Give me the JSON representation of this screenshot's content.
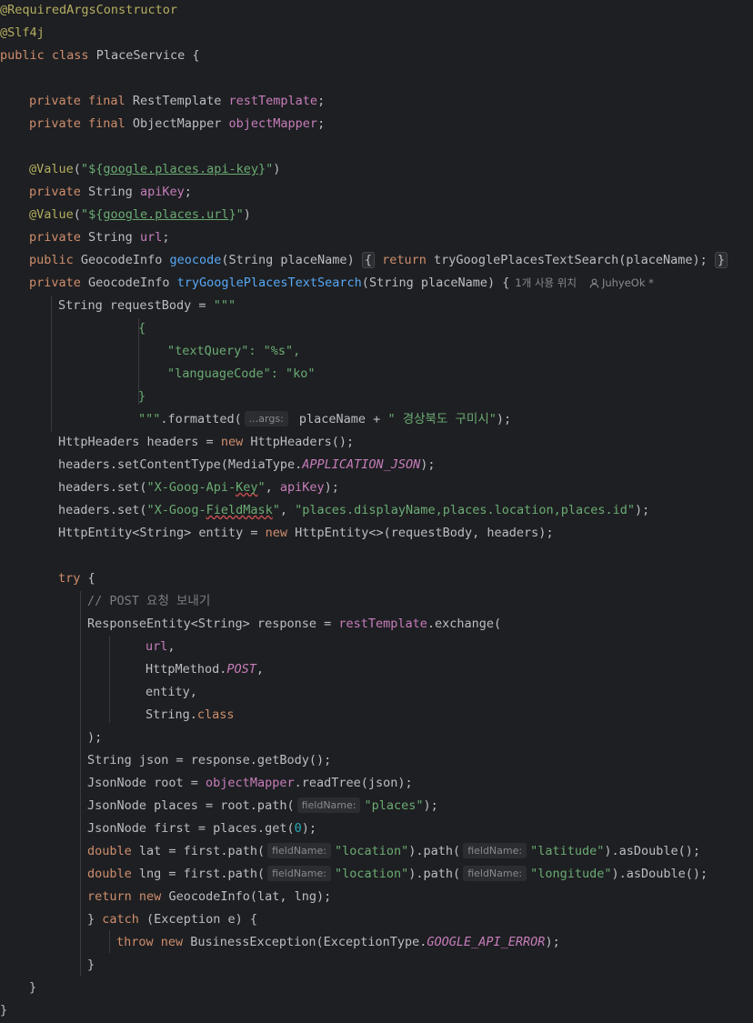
{
  "code": {
    "annotation_required_args": "@RequiredArgsConstructor",
    "annotation_slf4j": "@Slf4j",
    "kw_public": "public",
    "kw_class": "class",
    "class_name": "PlaceService",
    "brace_open": "{",
    "brace_close": "}",
    "kw_private": "private",
    "kw_final": "final",
    "type_rest_template": "RestTemplate",
    "field_rest_template": "restTemplate",
    "type_object_mapper": "ObjectMapper",
    "field_object_mapper": "objectMapper",
    "semicolon": ";",
    "annotation_value": "@Value",
    "paren_open": "(",
    "paren_close": ")",
    "quote": "\"",
    "dollar_brace": "${",
    "api_key_property": "google.places.api-key",
    "url_property": "google.places.url",
    "type_string": "String",
    "field_api_key": "apiKey",
    "field_url": "url",
    "type_geocode_info": "GeocodeInfo",
    "method_geocode": "geocode",
    "param_place_name": "String placeName",
    "kw_return": "return",
    "call_try_google": "tryGooglePlacesTextSearch(placeName);",
    "method_try_google": "tryGooglePlacesTextSearch",
    "usage_lens": "1개 사용 위치",
    "author_lens": "JuhyeOk *",
    "request_body_decl": "String requestBody = ",
    "text_block_open": "\"\"\"",
    "json_brace_open": "{",
    "json_text_query": "\"textQuery\": \"%s\",",
    "json_language_code": "\"languageCode\": \"ko\"",
    "json_brace_close": "}",
    "text_block_close": "\"\"\"",
    "formatted_call": ".formatted(",
    "hint_args": "...args:",
    "formatted_arg": " placeName + ",
    "location_string": "\" 경상북도 구미시\"",
    "close_paren_semi": ");",
    "headers_decl_prefix": "HttpHeaders headers = ",
    "kw_new": "new",
    "headers_ctor": " HttpHeaders();",
    "set_content_type": "headers.setContentType(MediaType.",
    "const_application_json": "APPLICATION_JSON",
    "headers_set": "headers.set(",
    "str_api_key_header_prefix": "\"X-Goog-Api-",
    "str_api_key_header_key": "Key",
    "str_field_mask_prefix": "\"X-Goog-",
    "str_field_mask_word": "FieldMask",
    "comma_space": ", ",
    "var_api_key_arg": "apiKey",
    "str_field_mask_value": "\"places.displayName,places.location,places.id\"",
    "entity_decl": "HttpEntity<String> entity = ",
    "entity_ctor": " HttpEntity<>(requestBody, headers);",
    "kw_try": "try",
    "comment_post": "// POST 요청 보내기",
    "response_decl": "ResponseEntity<String> response = ",
    "exchange_call": ".exchange(",
    "arg_url": "url",
    "comma": ",",
    "http_method": "HttpMethod.",
    "const_post": "POST",
    "arg_entity": "entity,",
    "arg_string": "String.",
    "kw_class_literal": "class",
    "json_decl": "String json = response.getBody();",
    "root_decl": "JsonNode root = ",
    "read_tree": ".readTree(json);",
    "places_decl": "JsonNode places = root.path(",
    "hint_field_name": "fieldName:",
    "str_places": "\"places\"",
    "first_decl": "JsonNode first = places.get(",
    "num_zero": "0",
    "kw_double": "double",
    "lat_decl": " lat = first.path(",
    "lng_decl": " lng = first.path(",
    "str_location": "\"location\"",
    "path_call": ").path(",
    "str_latitude": "\"latitude\"",
    "str_longitude": "\"longitude\"",
    "as_double": ").asDouble();",
    "return_ctor": " GeocodeInfo(lat, lng);",
    "kw_catch": "catch",
    "catch_params": " (Exception e) {",
    "kw_throw": "throw",
    "business_exception": " BusinessException(ExceptionType.",
    "const_google_api_error": "GOOGLE_API_ERROR"
  },
  "colors": {
    "background": "#1e1f22",
    "default_text": "#bcbec4",
    "keyword": "#cf8e6d",
    "annotation": "#b3ae60",
    "string": "#6aab73",
    "field": "#c77dbb",
    "method_declaration": "#56a8f5",
    "number": "#2aacb8",
    "comment": "#7a7e85"
  }
}
